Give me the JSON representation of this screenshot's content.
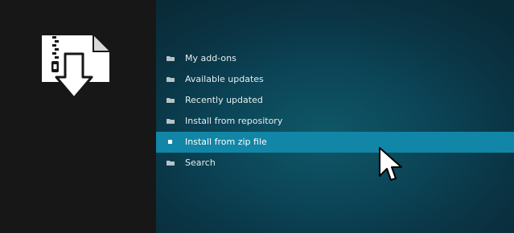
{
  "sidebar": {
    "icon": "zip-file-install-icon"
  },
  "menu": {
    "items": [
      {
        "label": "My add-ons",
        "icon": "folder-icon"
      },
      {
        "label": "Available updates",
        "icon": "folder-icon"
      },
      {
        "label": "Recently updated",
        "icon": "folder-icon"
      },
      {
        "label": "Install from repository",
        "icon": "folder-icon"
      },
      {
        "label": "Install from zip file",
        "icon": "bullet-icon",
        "selected": true
      },
      {
        "label": "Search",
        "icon": "folder-icon"
      }
    ]
  },
  "colors": {
    "sidebar_bg": "#171717",
    "main_bg": "#0b4456",
    "selection": "#1286a6",
    "text": "#e6eef0"
  }
}
